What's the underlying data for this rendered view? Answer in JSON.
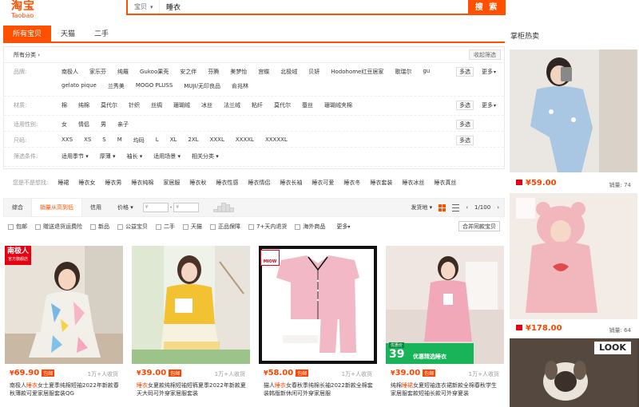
{
  "header": {
    "logo_cn": "淘宝",
    "logo_en": "Taobao",
    "search_category": "宝贝",
    "search_query": "睡衣",
    "search_button": "搜 索"
  },
  "tabs": [
    "所有宝贝",
    "天猫",
    "二手"
  ],
  "sidebar_title": "掌柜热卖",
  "filter": {
    "crumb": "所有分类",
    "collapse": "收起筛选",
    "rows": [
      {
        "label": "品牌:",
        "options": [
          "南极人",
          "家乐芬",
          "纯羅",
          "Gukoo果壳",
          "安之伴",
          "芬腾",
          "美梦怡",
          "宫蝶",
          "北极绒",
          "贝妍",
          "Hodohome红豆居家",
          "歌瑞尔",
          "gu",
          "gelato pique",
          "兰秀美",
          "MOGO PLUSS",
          "MUJI/无印良品",
          "俞兆林"
        ],
        "multi": "多选",
        "more": "更多"
      },
      {
        "label": "材质:",
        "options": [
          "棉",
          "纯棉",
          "莫代尔",
          "针织",
          "丝绸",
          "珊瑚绒",
          "冰丝",
          "法兰绒",
          "粘纤",
          "莫代尔",
          "蚕丝",
          "珊瑚绒夹棉"
        ],
        "multi": "多选",
        "more": "更多"
      },
      {
        "label": "适用性别:",
        "options": [
          "女",
          "情侣",
          "男",
          "亲子"
        ],
        "multi": "多选",
        "more": ""
      },
      {
        "label": "尺码:",
        "options": [
          "XXS",
          "XS",
          "S",
          "M",
          "均码",
          "L",
          "XL",
          "2XL",
          "XXXL",
          "XXXXL",
          "XXXXXL"
        ],
        "multi": "多选",
        "more": ""
      },
      {
        "label": "筛选条件:",
        "options": [
          "适用季节 ▾",
          "厚薄 ▾",
          "袖长 ▾",
          "适用场景 ▾",
          "相关分类 ▾"
        ],
        "multi": "",
        "more": ""
      }
    ]
  },
  "suggest": {
    "label": "您是不是想找:",
    "items": [
      "睡裙",
      "睡衣女",
      "睡衣男",
      "睡衣纯棉",
      "家居服",
      "睡衣秋",
      "睡衣性感",
      "睡衣情侣",
      "睡衣长袖",
      "睡衣可爱",
      "睡衣冬",
      "睡衣套装",
      "睡衣冰丝",
      "睡衣真丝"
    ]
  },
  "sortbar": {
    "items": [
      "综合",
      "销量从高到低",
      "信用",
      "价格"
    ],
    "price_from": "¥",
    "price_to": "¥",
    "ship_from": "发货地",
    "pager": "1/100"
  },
  "checks": {
    "items": [
      "包邮",
      "赠送退货运费险",
      "新品",
      "公益宝贝",
      "二手",
      "天猫",
      "正品保障",
      "7+天内退货",
      "海外商品"
    ],
    "more": "更多",
    "merge": "合并同款宝贝"
  },
  "products": [
    {
      "price": "69.90",
      "baoyou": "包邮",
      "sales": "1万+人收货",
      "title_a": "南极人",
      "title_hl": "睡衣",
      "title_b": "女士夏季纯棉短袖2022年新款春秋薄款可爱家居服套装QG",
      "badge": "南极人",
      "badge_sub": "官方旗舰店"
    },
    {
      "price": "39.00",
      "baoyou": "包邮",
      "sales": "1万+人收货",
      "title_a": "",
      "title_hl": "睡衣",
      "title_b": "女夏款纯棉短袖短裤夏季2022年新款夏天大码可外穿家居服套装",
      "badge": "",
      "badge_sub": ""
    },
    {
      "price": "58.00",
      "baoyou": "包邮",
      "sales": "1万+人收货",
      "title_a": "猫人",
      "title_hl": "睡衣",
      "title_b": "女春秋季纯棉长袖2022新款全棉套装韩版新休闲可外穿家居服",
      "badge": "MIOW",
      "badge_sub": ""
    },
    {
      "price": "39.00",
      "baoyou": "包邮",
      "sales": "1万+人收货",
      "title_a": "纯棉",
      "title_hl": "睡裙",
      "title_b": "女夏短袖连衣裙新款全棉春秋学生家居服套款短袖长款可外穿夏装",
      "badge": "",
      "badge_sub": "",
      "promo_big": "39",
      "promo_txt": "优惠精选睡衣",
      "promo_sm": "优惠价"
    }
  ],
  "side_products": [
    {
      "price": "59.00",
      "sales_label": "销量:",
      "sales": "74"
    },
    {
      "price": "178.00",
      "sales_label": "销量:",
      "sales": "64"
    }
  ],
  "side_banner": "LOOK"
}
